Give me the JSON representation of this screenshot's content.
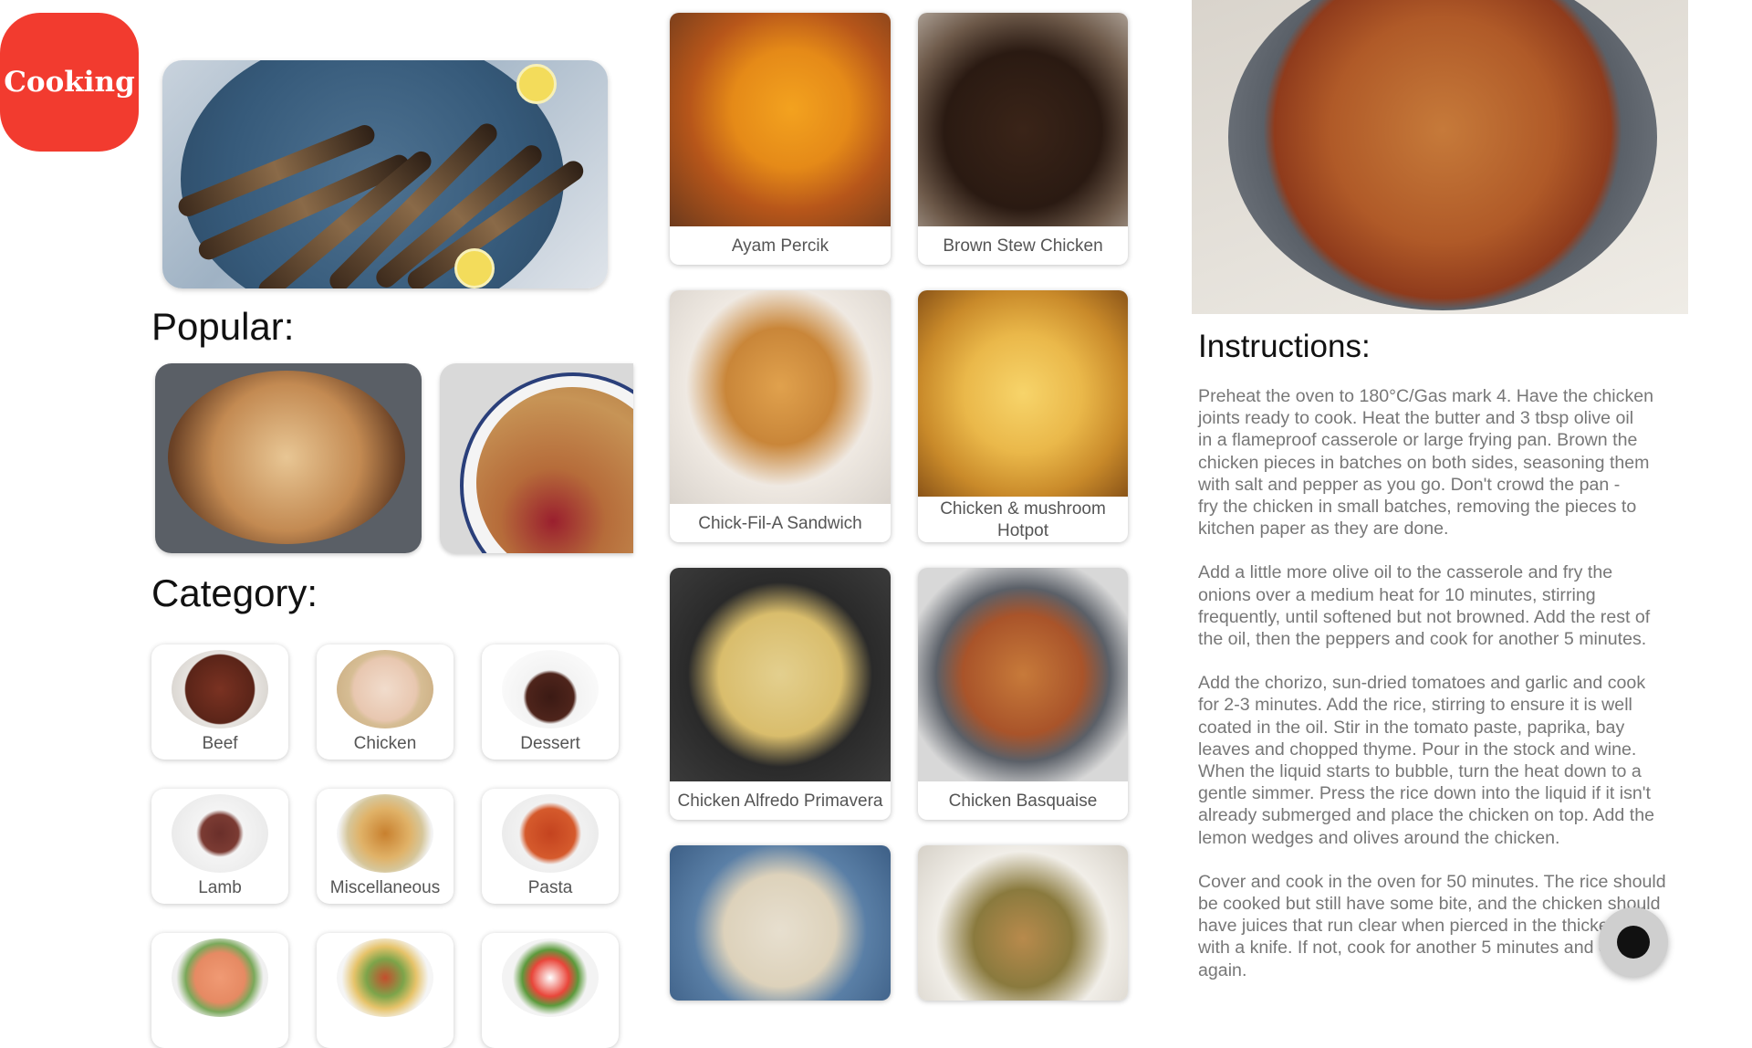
{
  "app": {
    "logo_text": "Cooking",
    "brand_color": "#f23b2f"
  },
  "hero": {
    "image": "grilled-sardines-photo"
  },
  "popular": {
    "title": "Popular:",
    "items": [
      {
        "image": "apple-tart-photo"
      },
      {
        "image": "berry-crumble-photo"
      }
    ]
  },
  "category": {
    "title": "Category:",
    "items": [
      {
        "label": "Beef",
        "image": "steak-photo"
      },
      {
        "label": "Chicken",
        "image": "raw-chicken-photo"
      },
      {
        "label": "Dessert",
        "image": "chocolate-cake-photo"
      },
      {
        "label": "Lamb",
        "image": "lamb-rack-photo"
      },
      {
        "label": "Miscellaneous",
        "image": "tacos-photo"
      },
      {
        "label": "Pasta",
        "image": "penne-photo"
      },
      {
        "label": "",
        "image": "salmon-plate-photo"
      },
      {
        "label": "",
        "image": "mixed-bowls-photo"
      },
      {
        "label": "",
        "image": "caprese-photo"
      }
    ]
  },
  "recipes": [
    {
      "label": "Ayam Percik",
      "image": "ayam-percik-photo"
    },
    {
      "label": "Brown Stew Chicken",
      "image": "brown-stew-chicken-photo"
    },
    {
      "label": "Chick-Fil-A Sandwich",
      "image": "chicken-sandwich-photo"
    },
    {
      "label": "Chicken & mushroom Hotpot",
      "image": "potato-hotpot-photo"
    },
    {
      "label": "Chicken Alfredo Primavera",
      "image": "alfredo-pasta-photo"
    },
    {
      "label": "Chicken Basquaise",
      "image": "basquaise-photo"
    },
    {
      "label": "",
      "image": "congee-photo"
    },
    {
      "label": "",
      "image": "chicken-beans-photo"
    }
  ],
  "detail": {
    "image": "chicken-basquaise-pot-photo",
    "instructions_title": "Instructions:",
    "paragraphs": [
      "Preheat the oven to 180°C/Gas mark 4. Have the chicken\njoints ready to cook. Heat the butter and 3 tbsp olive oil\nin a flameproof casserole or large frying pan. Brown the\nchicken pieces in batches on both sides, seasoning them\nwith salt and pepper as you go. Don't crowd the pan -\nfry the chicken in small batches, removing the pieces to\nkitchen paper as they are done.",
      "Add a little more olive oil to the casserole and fry the\nonions over a medium heat for 10 minutes, stirring\nfrequently, until softened but not browned. Add the rest of\nthe oil, then the peppers and cook for another 5 minutes.",
      "Add the chorizo, sun-dried tomatoes and garlic and cook\nfor 2-3 minutes. Add the rice, stirring to ensure it is well\ncoated in the oil. Stir in the tomato paste, paprika, bay\nleaves and chopped thyme. Pour in the stock and wine.\nWhen the liquid starts to bubble, turn the heat down to a\ngentle simmer. Press the rice down into the liquid if it isn't\nalready submerged and place the chicken on top. Add the\nlemon wedges and olives around the chicken.",
      "Cover and cook in the oven for 50 minutes. The rice should\nbe cooked but still have some bite, and the chicken should\nhave juices that run clear when pierced in the thickest part\nwith a knife. If not, cook for another 5 minutes and check\nagain."
    ]
  },
  "fab": {
    "icon": "record-dot-icon"
  }
}
